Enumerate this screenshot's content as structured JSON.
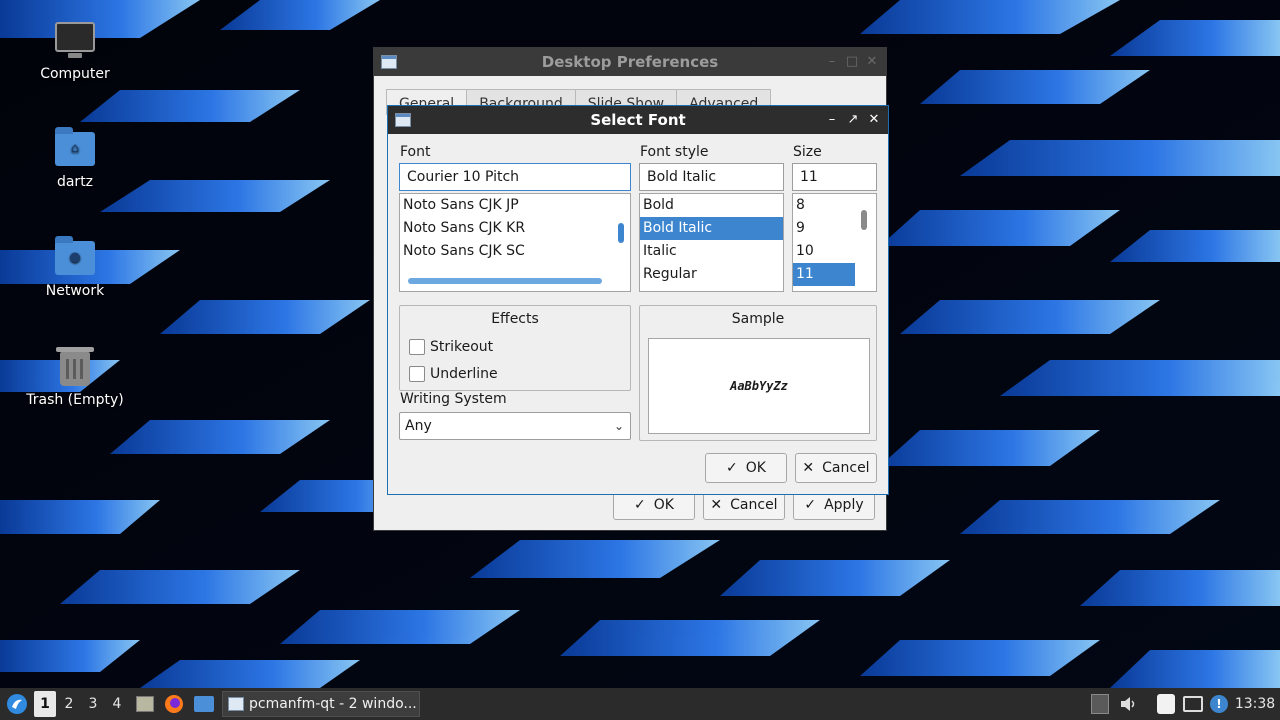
{
  "desktop": {
    "icons": [
      {
        "label": "Computer",
        "icon": "computer-icon"
      },
      {
        "label": "dartz",
        "icon": "home-folder-icon"
      },
      {
        "label": "Network",
        "icon": "network-folder-icon"
      },
      {
        "label": "Trash (Empty)",
        "icon": "trash-icon"
      }
    ]
  },
  "prefs_window": {
    "title": "Desktop Preferences",
    "tabs": [
      "General",
      "Background",
      "Slide Show",
      "Advanced"
    ],
    "buttons": {
      "ok": "OK",
      "cancel": "Cancel",
      "apply": "Apply"
    }
  },
  "font_dialog": {
    "title": "Select Font",
    "font_label": "Font",
    "font_value": "Courier 10 Pitch",
    "font_items": [
      "Noto Sans CJK JP",
      "Noto Sans CJK KR",
      "Noto Sans CJK SC"
    ],
    "style_label": "Font style",
    "style_value": "Bold Italic",
    "style_items": [
      "Bold",
      "Bold Italic",
      "Italic",
      "Regular"
    ],
    "style_selected": "Bold Italic",
    "size_label": "Size",
    "size_value": "11",
    "size_items": [
      "8",
      "9",
      "10",
      "11"
    ],
    "size_selected": "11",
    "effects_title": "Effects",
    "strikeout_label": "Strikeout",
    "underline_label": "Underline",
    "writing_system_label": "Writing System",
    "writing_system_value": "Any",
    "sample_title": "Sample",
    "sample_text": "AaBbYyZz",
    "buttons": {
      "ok": "OK",
      "cancel": "Cancel"
    }
  },
  "taskbar": {
    "desktops": [
      "1",
      "2",
      "3",
      "4"
    ],
    "active_desktop": "1",
    "task_label": "pcmanfm-qt - 2 windo...",
    "clock": "13:38"
  },
  "colors": {
    "accent": "#3d86cf",
    "titlebar": "#2d2d2d",
    "taskbar": "#2b2b2b",
    "window_bg": "#efefef"
  }
}
